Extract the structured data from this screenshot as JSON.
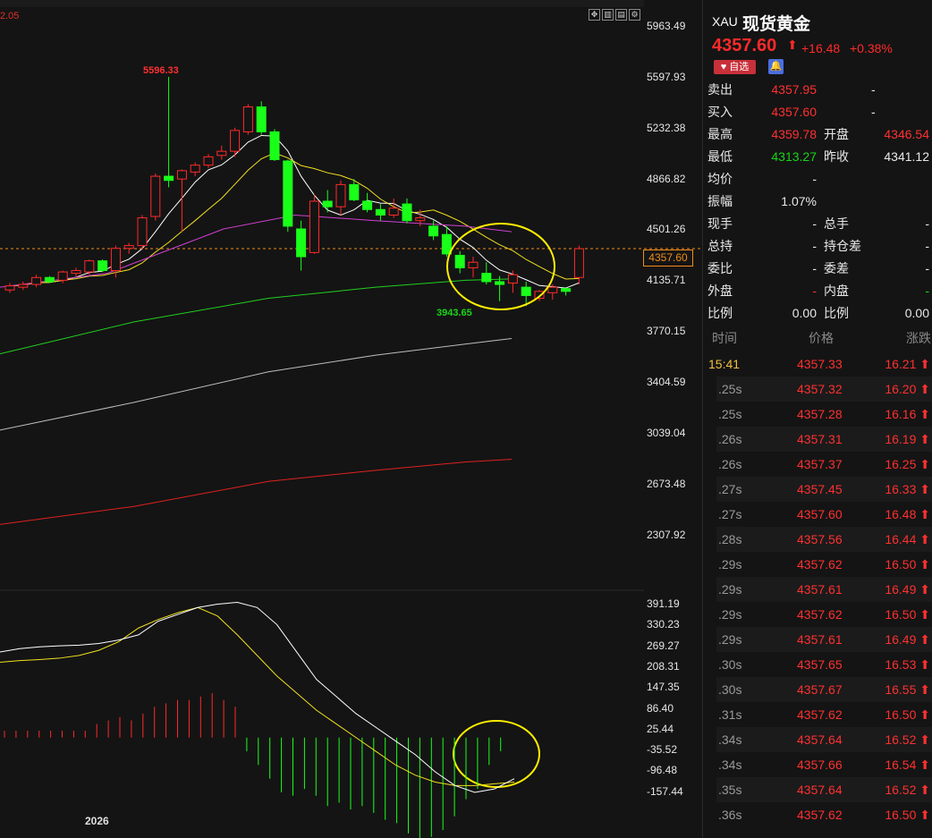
{
  "chart": {
    "corner_value": "2.05",
    "year_label": "2026",
    "high_marker": "5596.33",
    "low_marker": "3943.65",
    "price_tag": "4357.60",
    "price_axis": [
      "5963.49",
      "5597.93",
      "5232.38",
      "4866.82",
      "4501.26",
      "4135.71",
      "3770.15",
      "3404.59",
      "3039.04",
      "2673.48",
      "2307.92"
    ],
    "macd_axis": [
      "391.19",
      "330.23",
      "269.27",
      "208.31",
      "147.35",
      "86.40",
      "25.44",
      "-35.52",
      "-96.48",
      "-157.44"
    ],
    "colors": {
      "up": "#ff2a2a",
      "down": "#19ff19",
      "ma5": "#ffffff",
      "ma10": "#f0e020",
      "ma20": "#20d020",
      "ma60": "#d040d0",
      "ma120": "#bdbdbd",
      "ma250": "#e02020",
      "highlight": "#ffee00"
    },
    "toolbar_icons": [
      "move-icon",
      "candle-toggle-icon",
      "layout-icon",
      "settings-icon"
    ]
  },
  "chart_data": {
    "type": "candlestick",
    "title": "",
    "ohlc": [
      [
        4060,
        4110,
        4040,
        4090
      ],
      [
        4080,
        4120,
        4060,
        4100
      ],
      [
        4100,
        4170,
        4080,
        4150
      ],
      [
        4150,
        4160,
        4110,
        4120
      ],
      [
        4130,
        4200,
        4110,
        4190
      ],
      [
        4180,
        4220,
        4160,
        4200
      ],
      [
        4190,
        4280,
        4170,
        4270
      ],
      [
        4270,
        4280,
        4190,
        4200
      ],
      [
        4200,
        4380,
        4150,
        4360
      ],
      [
        4360,
        4400,
        4320,
        4380
      ],
      [
        4380,
        4600,
        4350,
        4580
      ],
      [
        4590,
        4900,
        4560,
        4880
      ],
      [
        4880,
        5596.33,
        4800,
        4850
      ],
      [
        4860,
        4930,
        4480,
        4920
      ],
      [
        4910,
        4980,
        4880,
        4960
      ],
      [
        4960,
        5040,
        4940,
        5020
      ],
      [
        5030,
        5100,
        5000,
        5060
      ],
      [
        5060,
        5230,
        5020,
        5210
      ],
      [
        5200,
        5400,
        5180,
        5380
      ],
      [
        5380,
        5420,
        5180,
        5200
      ],
      [
        5200,
        5220,
        4990,
        5000
      ],
      [
        4990,
        5000,
        4480,
        4520
      ],
      [
        4500,
        4560,
        4200,
        4300
      ],
      [
        4330,
        4750,
        4320,
        4700
      ],
      [
        4700,
        4780,
        4620,
        4660
      ],
      [
        4660,
        4850,
        4600,
        4820
      ],
      [
        4820,
        4860,
        4700,
        4710
      ],
      [
        4700,
        4760,
        4620,
        4640
      ],
      [
        4640,
        4680,
        4560,
        4600
      ],
      [
        4600,
        4720,
        4580,
        4650
      ],
      [
        4680,
        4720,
        4540,
        4560
      ],
      [
        4560,
        4640,
        4520,
        4580
      ],
      [
        4520,
        4560,
        4420,
        4450
      ],
      [
        4460,
        4520,
        4300,
        4320
      ],
      [
        4310,
        4340,
        4180,
        4220
      ],
      [
        4220,
        4300,
        4150,
        4260
      ],
      [
        4180,
        4260,
        4100,
        4120
      ],
      [
        4120,
        4160,
        3980,
        4100
      ],
      [
        4110,
        4200,
        4040,
        4170
      ],
      [
        4080,
        4120,
        3943.65,
        4020
      ],
      [
        4000,
        4060,
        3980,
        4050
      ],
      [
        4040,
        4100,
        3990,
        4080
      ],
      [
        4070,
        4080,
        4020,
        4050
      ],
      [
        4150,
        4380,
        4100,
        4357.6
      ]
    ],
    "macd_hist": [
      20,
      20,
      20,
      20,
      20,
      20,
      20,
      20,
      40,
      50,
      60,
      50,
      70,
      90,
      100,
      110,
      110,
      120,
      130,
      110,
      90,
      -40,
      -80,
      -120,
      -160,
      -170,
      -150,
      -170,
      -200,
      -190,
      -210,
      -200,
      -220,
      -240,
      -250,
      -280,
      -300,
      -290,
      -270,
      -230,
      -180,
      -150,
      -80,
      -40
    ],
    "dif": [
      250,
      260,
      265,
      268,
      270,
      275,
      285,
      300,
      340,
      360,
      380,
      390,
      395,
      380,
      330,
      250,
      170,
      120,
      70,
      30,
      -10,
      -50,
      -100,
      -140,
      -160,
      -150,
      -120
    ],
    "dea": [
      220,
      225,
      228,
      232,
      240,
      255,
      280,
      320,
      345,
      365,
      380,
      355,
      300,
      240,
      180,
      130,
      80,
      40,
      0,
      -40,
      -80,
      -110,
      -130,
      -140,
      -140,
      -135,
      -130
    ]
  },
  "panel": {
    "symbol_code": "XAU",
    "symbol_name": "现货黄金",
    "last": "4357.60",
    "change": "+16.48",
    "change_pct": "+0.38%",
    "fav_label": "自选",
    "quote_rows": [
      {
        "l1": "卖出",
        "v1": "4357.95",
        "c1": "red",
        "l2": "",
        "v2": "-",
        "c2": "white"
      },
      {
        "l1": "买入",
        "v1": "4357.60",
        "c1": "red",
        "l2": "",
        "v2": "-",
        "c2": "white"
      },
      {
        "l1": "最高",
        "v1": "4359.78",
        "c1": "red",
        "l2": "开盘",
        "v2": "4346.54",
        "c2": "red"
      },
      {
        "l1": "最低",
        "v1": "4313.27",
        "c1": "green",
        "l2": "昨收",
        "v2": "4341.12",
        "c2": "white"
      },
      {
        "l1": "均价",
        "v1": "-",
        "c1": "white",
        "l2": "",
        "v2": "",
        "c2": "white"
      },
      {
        "l1": "振幅",
        "v1": "1.07%",
        "c1": "white",
        "l2": "",
        "v2": "",
        "c2": "white"
      },
      {
        "l1": "现手",
        "v1": "-",
        "c1": "white",
        "l2": "总手",
        "v2": "-",
        "c2": "white"
      },
      {
        "l1": "总持",
        "v1": "-",
        "c1": "white",
        "l2": "持仓差",
        "v2": "-",
        "c2": "white"
      },
      {
        "l1": "委比",
        "v1": "-",
        "c1": "white",
        "l2": "委差",
        "v2": "-",
        "c2": "white"
      },
      {
        "l1": "外盘",
        "v1": "-",
        "c1": "red",
        "l2": "内盘",
        "v2": "-",
        "c2": "green"
      },
      {
        "l1": "比例",
        "v1": "0.00",
        "c1": "white",
        "l2": "比例",
        "v2": "0.00",
        "c2": "white"
      }
    ],
    "tick_headers": {
      "time": "时间",
      "price": "价格",
      "change": "涨跌"
    },
    "ticks": [
      {
        "t": "15:41",
        "p": "4357.33",
        "c": "16.21"
      },
      {
        "t": ".25s",
        "p": "4357.32",
        "c": "16.20"
      },
      {
        "t": ".25s",
        "p": "4357.28",
        "c": "16.16"
      },
      {
        "t": ".26s",
        "p": "4357.31",
        "c": "16.19"
      },
      {
        "t": ".26s",
        "p": "4357.37",
        "c": "16.25"
      },
      {
        "t": ".27s",
        "p": "4357.45",
        "c": "16.33"
      },
      {
        "t": ".27s",
        "p": "4357.60",
        "c": "16.48"
      },
      {
        "t": ".28s",
        "p": "4357.56",
        "c": "16.44"
      },
      {
        "t": ".29s",
        "p": "4357.62",
        "c": "16.50"
      },
      {
        "t": ".29s",
        "p": "4357.61",
        "c": "16.49"
      },
      {
        "t": ".29s",
        "p": "4357.62",
        "c": "16.50"
      },
      {
        "t": ".29s",
        "p": "4357.61",
        "c": "16.49"
      },
      {
        "t": ".30s",
        "p": "4357.65",
        "c": "16.53"
      },
      {
        "t": ".30s",
        "p": "4357.67",
        "c": "16.55"
      },
      {
        "t": ".31s",
        "p": "4357.62",
        "c": "16.50"
      },
      {
        "t": ".34s",
        "p": "4357.64",
        "c": "16.52"
      },
      {
        "t": ".34s",
        "p": "4357.66",
        "c": "16.54"
      },
      {
        "t": ".35s",
        "p": "4357.64",
        "c": "16.52"
      },
      {
        "t": ".36s",
        "p": "4357.62",
        "c": "16.50"
      }
    ]
  }
}
